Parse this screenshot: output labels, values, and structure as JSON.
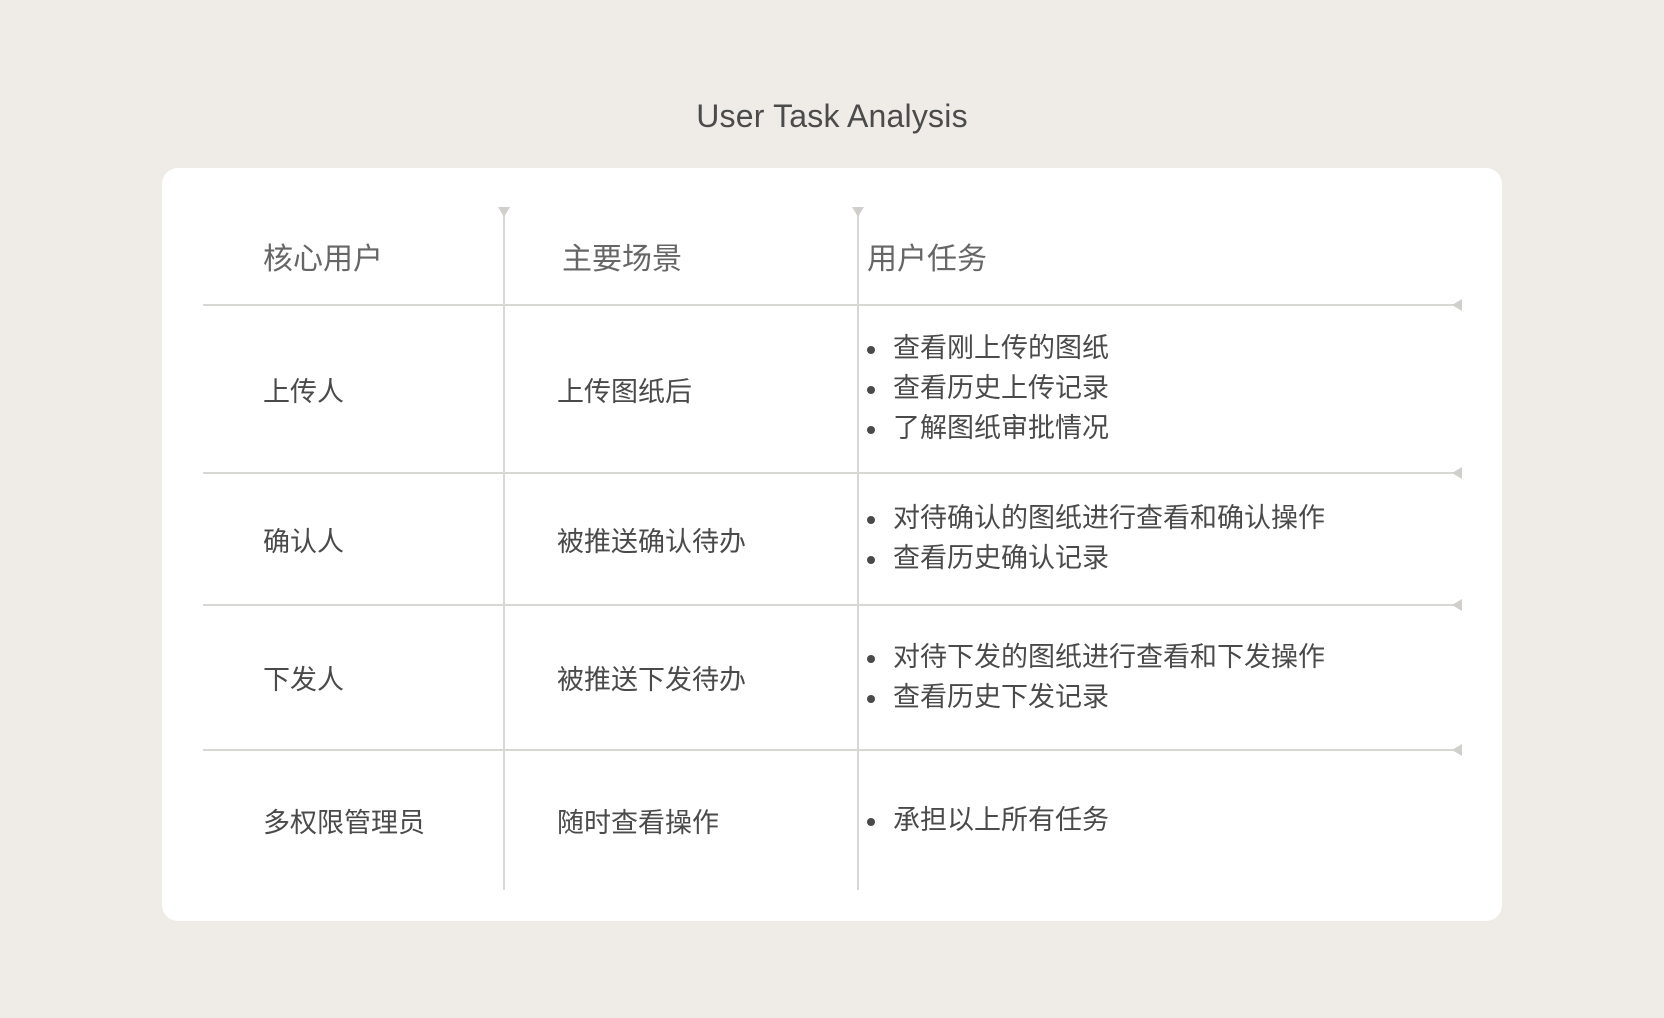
{
  "title": "User Task Analysis",
  "headers": [
    "核心用户",
    "主要场景",
    "用户任务"
  ],
  "rows": [
    {
      "user": "上传人",
      "scenario": "上传图纸后",
      "tasks": [
        "查看刚上传的图纸",
        "查看历史上传记录",
        "了解图纸审批情况"
      ]
    },
    {
      "user": "确认人",
      "scenario": "被推送确认待办",
      "tasks": [
        "对待确认的图纸进行查看和确认操作",
        "查看历史确认记录"
      ]
    },
    {
      "user": "下发人",
      "scenario": "被推送下发待办",
      "tasks": [
        "对待下发的图纸进行查看和下发操作",
        "查看历史下发记录"
      ]
    },
    {
      "user": "多权限管理员",
      "scenario": "随时查看操作",
      "tasks": [
        "承担以上所有任务"
      ]
    }
  ],
  "colors": {
    "background": "#efece7",
    "card": "#ffffff",
    "grid_line": "#d9d7d3",
    "text": "#4a4a4a",
    "header_text": "#666666"
  }
}
